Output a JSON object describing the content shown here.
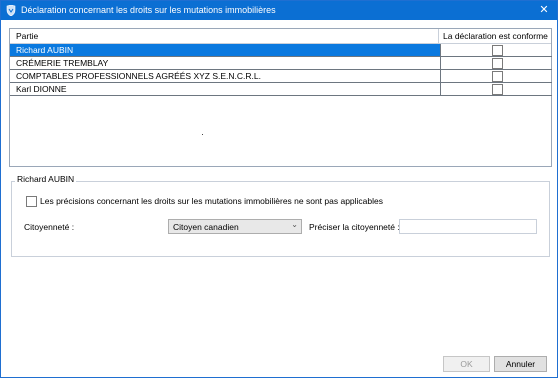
{
  "window": {
    "title": "Déclaration concernant les droits sur les mutations immobilières"
  },
  "grid": {
    "columns": [
      "Partie",
      "La déclaration est conforme"
    ],
    "rows": [
      {
        "party": "Richard AUBIN",
        "conforme": false,
        "selected": true
      },
      {
        "party": "CRÉMERIE TREMBLAY",
        "conforme": false,
        "selected": false
      },
      {
        "party": "COMPTABLES PROFESSIONNELS AGRÉÉS XYZ S.E.N.C.R.L.",
        "conforme": false,
        "selected": false
      },
      {
        "party": "Karl DIONNE",
        "conforme": false,
        "selected": false
      }
    ]
  },
  "detail": {
    "group_title": "Richard AUBIN",
    "checkbox_label": "Les précisions concernant les droits sur les mutations immobilières ne sont pas applicables",
    "checkbox_checked": false,
    "citizenship_label": "Citoyenneté :",
    "citizenship_value": "Citoyen canadien",
    "specify_label": "Préciser la citoyenneté :",
    "specify_value": ""
  },
  "buttons": {
    "ok": "OK",
    "cancel": "Annuler"
  },
  "colors": {
    "titlebar": "#0b6fd3",
    "selection": "#0a79df"
  }
}
